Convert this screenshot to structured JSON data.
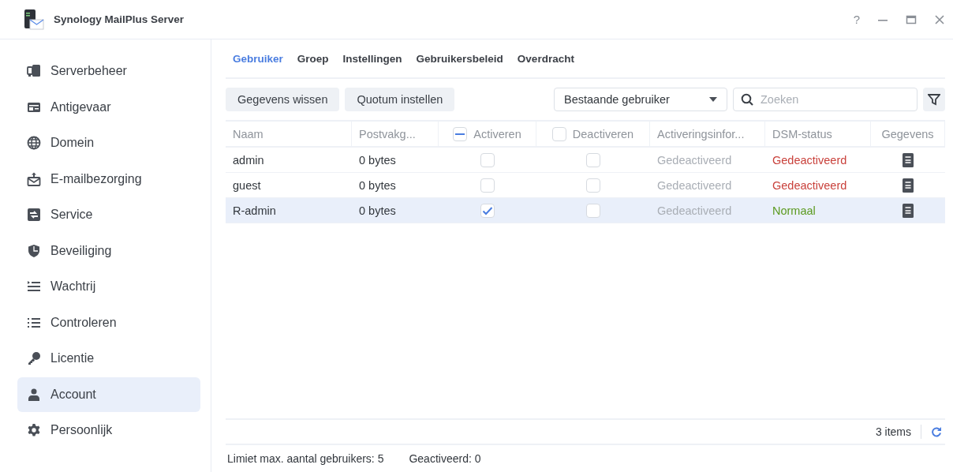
{
  "window": {
    "title": "Synology MailPlus Server",
    "controls": [
      "?"
    ]
  },
  "sidebar": {
    "items": [
      {
        "label": "Serverbeheer",
        "selected": false
      },
      {
        "label": "Antigevaar",
        "selected": false
      },
      {
        "label": "Domein",
        "selected": false
      },
      {
        "label": "E-mailbezorging",
        "selected": false
      },
      {
        "label": "Service",
        "selected": false
      },
      {
        "label": "Beveiliging",
        "selected": false
      },
      {
        "label": "Wachtrij",
        "selected": false
      },
      {
        "label": "Controleren",
        "selected": false
      },
      {
        "label": "Licentie",
        "selected": false
      },
      {
        "label": "Account",
        "selected": true
      },
      {
        "label": "Persoonlijk",
        "selected": false
      }
    ]
  },
  "tabs": [
    {
      "label": "Gebruiker",
      "selected": true
    },
    {
      "label": "Groep",
      "selected": false
    },
    {
      "label": "Instellingen",
      "selected": false
    },
    {
      "label": "Gebruikersbeleid",
      "selected": false
    },
    {
      "label": "Overdracht",
      "selected": false
    }
  ],
  "toolbar": {
    "buttons": [
      "Gegevens wissen",
      "Quotum instellen"
    ],
    "dropdown": "Bestaande gebruiker",
    "search": {
      "placeholder": "Zoeken"
    }
  },
  "table": {
    "columns": [
      {
        "label": "Naam",
        "kind": "text"
      },
      {
        "label": "Postvakg...",
        "kind": "text"
      },
      {
        "label": "Activeren",
        "kind": "check",
        "indeterminate": true
      },
      {
        "label": "Deactiveren",
        "kind": "check",
        "indeterminate": false
      },
      {
        "label": "Activeringsinfor...",
        "kind": "text"
      },
      {
        "label": "DSM-status",
        "kind": "text"
      },
      {
        "label": "Gegevens",
        "kind": "center"
      }
    ],
    "rows": [
      {
        "name": "admin",
        "quota": "0 bytes",
        "activate": false,
        "deactivate": false,
        "activation_info": "Gedeactiveerd",
        "dsm_status": "Gedeactiveerd",
        "color": "#c9413b",
        "selected": false
      },
      {
        "name": "guest",
        "quota": "0 bytes",
        "activate": false,
        "deactivate": false,
        "activation_info": "Gedeactiveerd",
        "dsm_status": "Gedeactiveerd",
        "color": "#c9413b",
        "selected": false
      },
      {
        "name": "R-admin",
        "quota": "0 bytes",
        "activate": true,
        "deactivate": false,
        "activation_info": "Gedeactiveerd",
        "dsm_status": "Normaal",
        "color": "#5b9a1f",
        "selected": true
      }
    ]
  },
  "pager": {
    "count": "3 items"
  },
  "status_bar": [
    "Limiet max. aantal gebruikers: 5",
    "Geactiveerd: 0"
  ]
}
